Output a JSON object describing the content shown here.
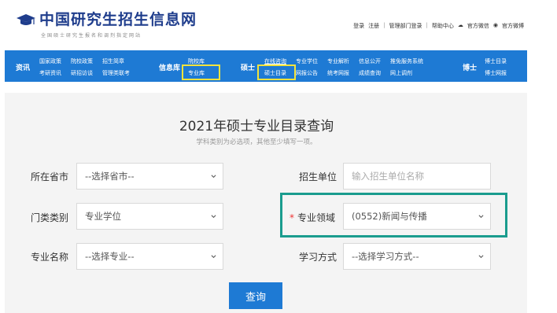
{
  "header": {
    "site_title": "中国研究生招生信息网",
    "site_subtitle": "全国硕士研究生报名和调剂指定网站",
    "top_links": [
      "登录",
      "注册",
      "管理部门登录",
      "帮助中心",
      "官方微信",
      "官方微博"
    ]
  },
  "nav": {
    "zixun": {
      "head": "资讯",
      "links": [
        "国家政策",
        "院校政策",
        "招生简章",
        "考研资讯",
        "研招访谈",
        "管理类联考"
      ]
    },
    "xinxiku": {
      "head": "信息库",
      "links": [
        "院校库",
        "专业库"
      ]
    },
    "shuoshi": {
      "head": "硕士",
      "links": [
        "在线咨询",
        "专业学位",
        "专业解析",
        "信息公开",
        "推免服务系统",
        "硕士目录",
        "网报公告",
        "统考网报",
        "成绩查询",
        "网上调剂"
      ]
    },
    "boshi": {
      "head": "博士",
      "links": [
        "博士目录",
        "博士网报"
      ]
    }
  },
  "form": {
    "title": "2021年硕士专业目录查询",
    "subtitle": "学科类别为必选项，其他至少填写一项。",
    "province": {
      "label": "所在省市",
      "value": "--选择省市--"
    },
    "unit": {
      "label": "招生单位",
      "placeholder": "输入招生单位名称"
    },
    "category": {
      "label": "门类类别",
      "value": "专业学位"
    },
    "field": {
      "required_mark": "*",
      "label": "专业领域",
      "value": "(0552)新闻与传播"
    },
    "major": {
      "label": "专业名称",
      "value": "--选择专业--"
    },
    "study_mode": {
      "label": "学习方式",
      "value": "--选择学习方式--"
    },
    "submit_label": "查询"
  },
  "colors": {
    "nav_bg": "#1e7ad4",
    "highlight_yellow": "#f2e33c",
    "highlight_teal": "#1a9c8e",
    "logo_blue": "#1f3d8c"
  }
}
